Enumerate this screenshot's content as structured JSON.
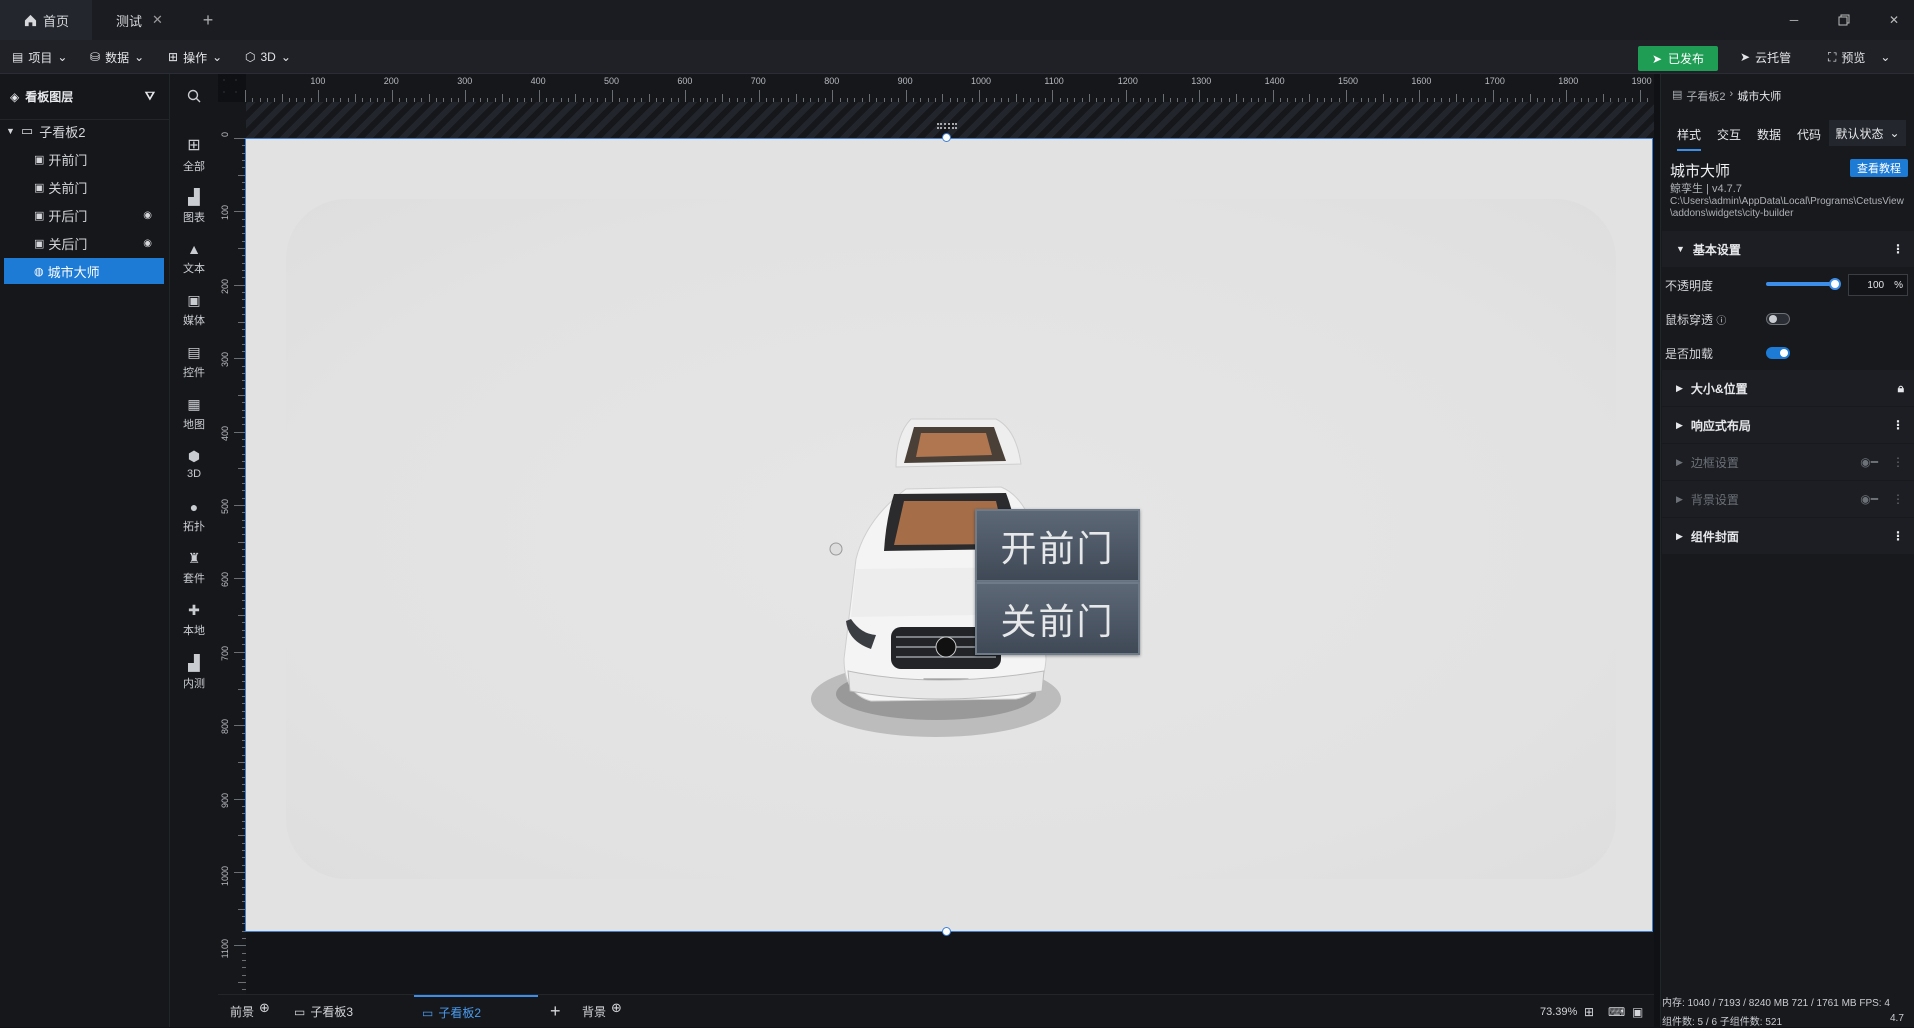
{
  "tabs": {
    "home": "首页",
    "current": "测试"
  },
  "menu": {
    "project": "项目",
    "data": "数据",
    "operate": "操作",
    "three_d": "3D"
  },
  "toolbar": {
    "publish": "已发布",
    "cloud": "云托管",
    "preview": "预览",
    "publish_color": "#1f9d55"
  },
  "layers": {
    "title": "看板图层",
    "group": "子看板2",
    "items": [
      "开前门",
      "关前门",
      "开后门",
      "关后门",
      "城市大师"
    ]
  },
  "tools": [
    "全部",
    "图表",
    "文本",
    "媒体",
    "控件",
    "地图",
    "3D",
    "拓扑",
    "套件",
    "本地",
    "内测"
  ],
  "ruler": {
    "top": [
      "100",
      "200",
      "300",
      "400",
      "500",
      "600",
      "700",
      "800",
      "900",
      "1000",
      "1100",
      "1200",
      "1300",
      "1400",
      "1500",
      "1600",
      "1700",
      "1800",
      "1900"
    ],
    "left": [
      "0",
      "100",
      "200",
      "300",
      "400",
      "500",
      "600",
      "700",
      "800",
      "900",
      "1000",
      "1100"
    ]
  },
  "stage": {
    "open_btn": "开前门",
    "close_btn": "关前门"
  },
  "bottom": {
    "foreground": "前景",
    "board3": "子看板3",
    "board2": "子看板2",
    "background": "背景",
    "zoom": "73.39%"
  },
  "props": {
    "breadcrumb_parent": "子看板2",
    "breadcrumb_current": "城市大师",
    "tabs": [
      "样式",
      "交互",
      "数据",
      "代码"
    ],
    "state": "默认状态",
    "widget_name": "城市大师",
    "tutorial": "查看教程",
    "author": "鲸孪生 | v4.7.7",
    "path": "C:\\Users\\admin\\AppData\\Local\\Programs\\CetusView\\addons\\widgets\\city-builder",
    "basic": "基本设置",
    "opacity_label": "不透明度",
    "opacity_value": "100",
    "opacity_unit": "%",
    "mouse_pass": "鼠标穿透",
    "is_load": "是否加载",
    "size_pos": "大小&位置",
    "responsive": "响应式布局",
    "border": "边框设置",
    "bg": "背景设置",
    "cover": "组件封面",
    "memory": "内存: 1040 / 7193 / 8240 MB  721 / 1761 MB FPS: 4",
    "count": "组件数: 5 / 6  子组件数: 521",
    "version": "4.7"
  }
}
